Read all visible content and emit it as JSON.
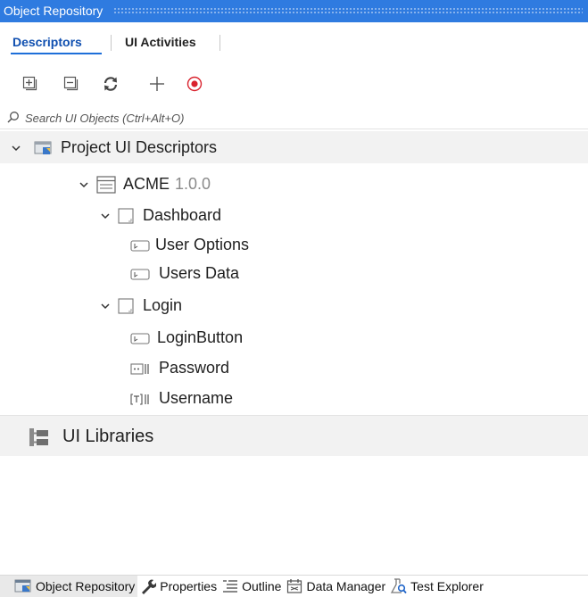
{
  "panel": {
    "title": "Object Repository"
  },
  "tabs": [
    {
      "label": "Descriptors"
    },
    {
      "label": "UI Activities"
    }
  ],
  "toolbar": {
    "buttons": [
      {
        "name": "expand-all-icon"
      },
      {
        "name": "collapse-all-icon"
      },
      {
        "name": "refresh-icon"
      },
      {
        "name": "add-icon"
      },
      {
        "name": "record-icon"
      }
    ]
  },
  "search": {
    "placeholder": "Search UI Objects (Ctrl+Alt+O)",
    "value": ""
  },
  "tree": {
    "root_label": "Project UI Descriptors",
    "app": {
      "label": "ACME",
      "version": "1.0.0"
    },
    "screens": [
      {
        "label": "Dashboard",
        "elements": [
          {
            "label": "User Options",
            "icon": "ui-element-icon"
          },
          {
            "label": "Users Data",
            "icon": "ui-element-icon"
          }
        ]
      },
      {
        "label": "Login",
        "elements": [
          {
            "label": "LoginButton",
            "icon": "ui-element-icon"
          },
          {
            "label": "Password",
            "icon": "password-field-icon"
          },
          {
            "label": "Username",
            "icon": "text-field-icon"
          }
        ]
      }
    ]
  },
  "libraries": {
    "label": "UI Libraries"
  },
  "bottom_tabs": [
    {
      "label": "Object Repository"
    },
    {
      "label": "Properties"
    },
    {
      "label": "Outline"
    },
    {
      "label": "Data Manager"
    },
    {
      "label": "Test Explorer"
    }
  ]
}
